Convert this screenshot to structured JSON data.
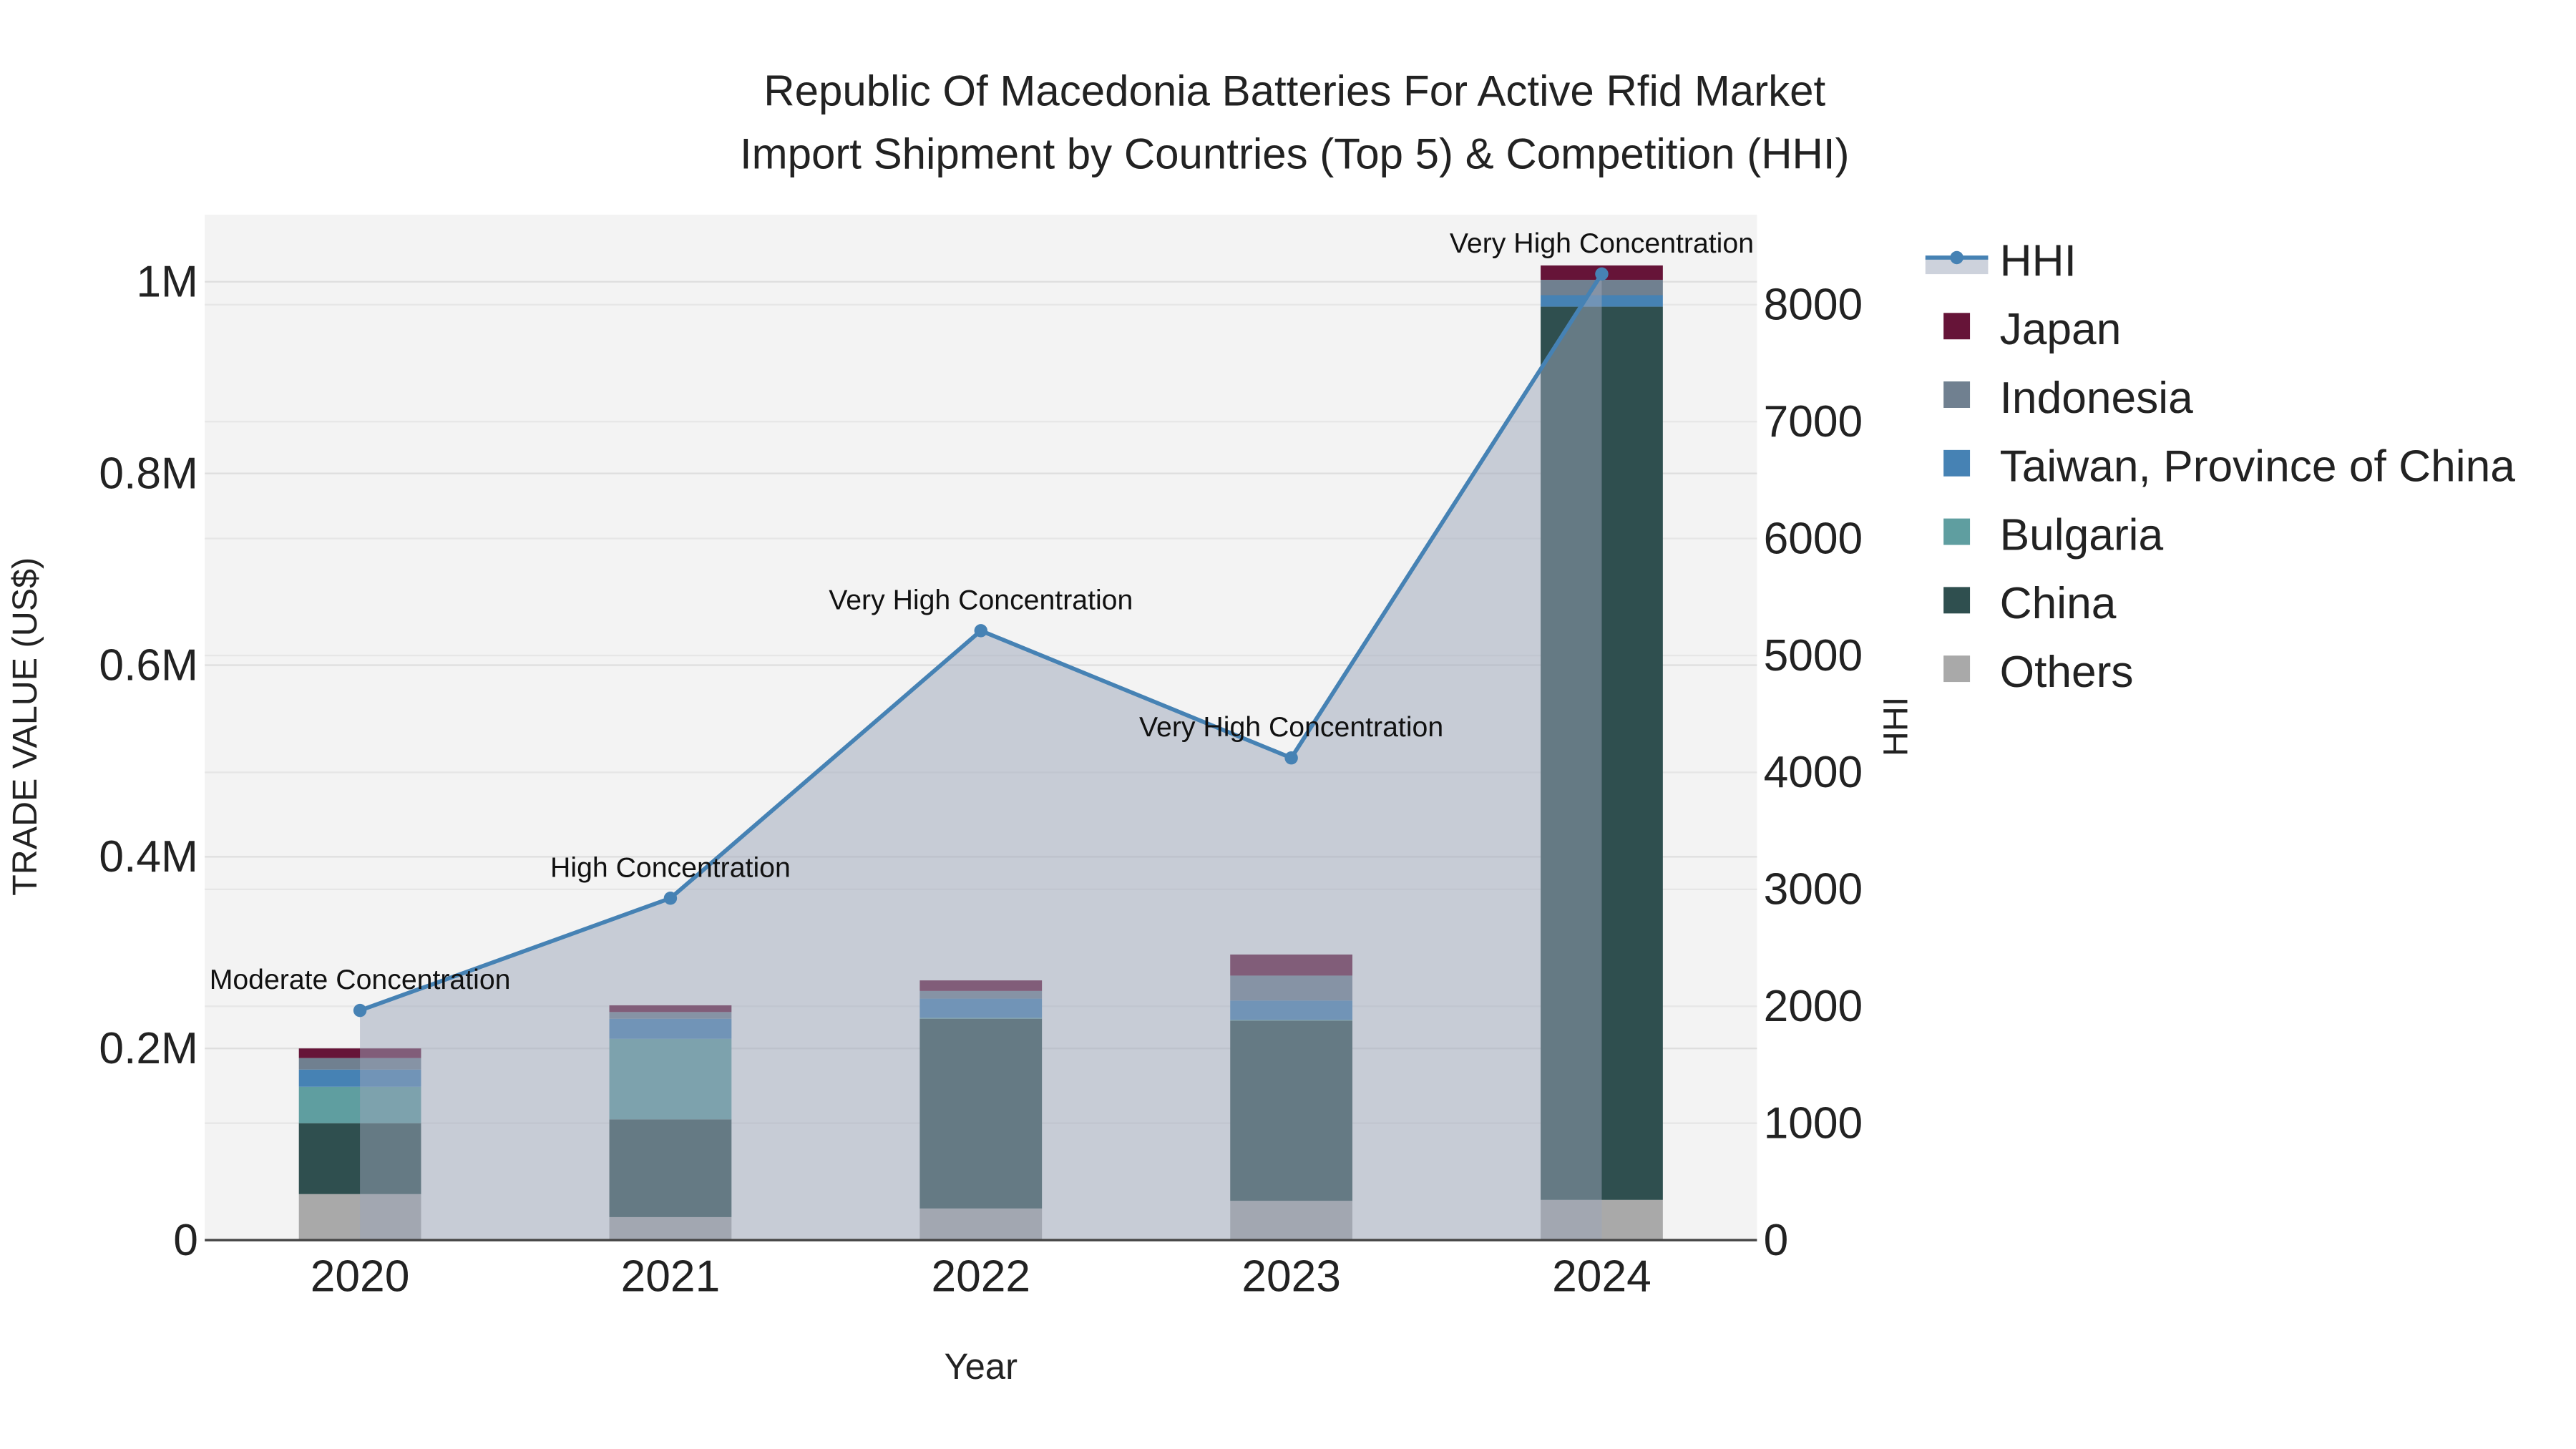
{
  "chart_data": {
    "type": "bar",
    "title_line1": "Republic Of Macedonia Batteries For Active Rfid Market",
    "title_line2": "Import Shipment by Countries (Top 5) & Competition (HHI)",
    "xlabel": "Year",
    "ylabel": "TRADE VALUE (US$)",
    "y2label": "HHI",
    "categories": [
      "2020",
      "2021",
      "2022",
      "2023",
      "2024"
    ],
    "ylim": [
      0,
      1.07
    ],
    "y_ticks": [
      {
        "v": 0,
        "label": "0"
      },
      {
        "v": 0.2,
        "label": "0.2M"
      },
      {
        "v": 0.4,
        "label": "0.4M"
      },
      {
        "v": 0.6,
        "label": "0.6M"
      },
      {
        "v": 0.8,
        "label": "0.8M"
      },
      {
        "v": 1.0,
        "label": "1M"
      }
    ],
    "y2lim": [
      0,
      8770
    ],
    "y2_ticks": [
      "0",
      "1000",
      "2000",
      "3000",
      "4000",
      "5000",
      "6000",
      "7000",
      "8000"
    ],
    "series": [
      {
        "name": "Others",
        "color": "#a9a9a9",
        "values": [
          0.048,
          0.024,
          0.033,
          0.041,
          0.042
        ]
      },
      {
        "name": "China",
        "color": "#2f4f4f",
        "values": [
          0.074,
          0.102,
          0.198,
          0.188,
          0.932
        ]
      },
      {
        "name": "Bulgaria",
        "color": "#5f9ea0",
        "values": [
          0.038,
          0.084,
          0.001,
          0.001,
          0.0
        ]
      },
      {
        "name": "Taiwan, Province of China",
        "color": "#4682b4",
        "values": [
          0.018,
          0.021,
          0.02,
          0.02,
          0.012
        ]
      },
      {
        "name": "Indonesia",
        "color": "#708090",
        "values": [
          0.012,
          0.007,
          0.008,
          0.026,
          0.016
        ]
      },
      {
        "name": "Japan",
        "color": "#661438",
        "values": [
          0.01,
          0.007,
          0.011,
          0.022,
          0.015
        ]
      }
    ],
    "hhi": {
      "name": "HHI",
      "color": "#4682b4",
      "values": [
        1964,
        2924,
        5212,
        4124,
        8263
      ],
      "annotations": [
        "Moderate Concentration",
        "High Concentration",
        "Very High Concentration",
        "Very High Concentration",
        "Very High Concentration"
      ]
    },
    "legend": {
      "placement": "right",
      "order": [
        "HHI",
        "Japan",
        "Indonesia",
        "Taiwan, Province of China",
        "Bulgaria",
        "China",
        "Others"
      ]
    },
    "grid": true
  }
}
